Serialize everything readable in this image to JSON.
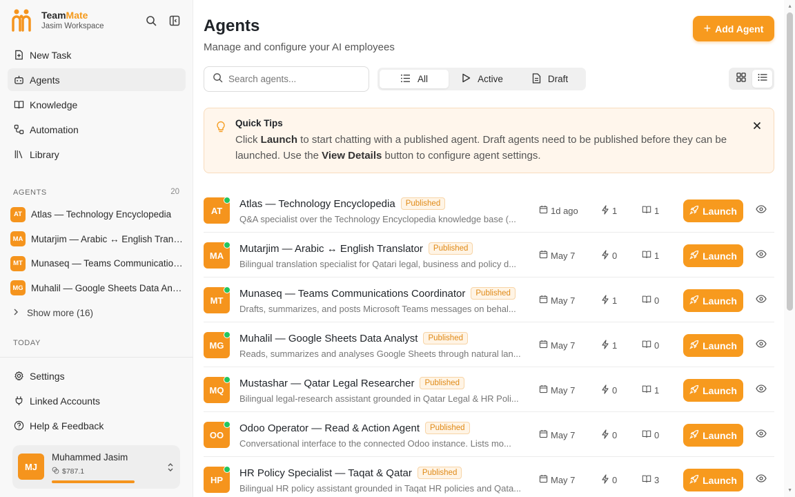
{
  "brand": {
    "name_part1": "Team",
    "name_part2": "Mate",
    "workspace": "Jasim Workspace"
  },
  "nav": [
    {
      "label": "New Task",
      "icon": "new-task-icon"
    },
    {
      "label": "Agents",
      "icon": "robot-icon",
      "active": true
    },
    {
      "label": "Knowledge",
      "icon": "book-icon"
    },
    {
      "label": "Automation",
      "icon": "workflow-icon"
    },
    {
      "label": "Library",
      "icon": "library-icon"
    }
  ],
  "sidebar_agents": {
    "title": "AGENTS",
    "count": "20",
    "items": [
      {
        "initials": "AT",
        "name": "Atlas — Technology Encyclopedia"
      },
      {
        "initials": "MA",
        "name": "Mutarjim — Arabic ↔ English Translator"
      },
      {
        "initials": "MT",
        "name": "Munaseq — Teams Communications Coordinator"
      },
      {
        "initials": "MG",
        "name": "Muhalil — Google Sheets Data Analyst"
      }
    ],
    "show_more": "Show more (16)"
  },
  "today_title": "TODAY",
  "bottom_nav": [
    {
      "label": "Settings",
      "icon": "gear-icon"
    },
    {
      "label": "Linked Accounts",
      "icon": "plug-icon"
    },
    {
      "label": "Help & Feedback",
      "icon": "help-icon"
    }
  ],
  "user": {
    "initials": "MJ",
    "name": "Muhammed Jasim",
    "balance": "$787.1"
  },
  "header": {
    "title": "Agents",
    "subtitle": "Manage and configure your AI employees",
    "add_button": "Add Agent"
  },
  "search": {
    "placeholder": "Search agents..."
  },
  "filters": [
    {
      "label": "All",
      "active": true
    },
    {
      "label": "Active"
    },
    {
      "label": "Draft"
    }
  ],
  "tips": {
    "title": "Quick Tips",
    "p1": "Click ",
    "b1": "Launch",
    "p2": " to start chatting with a published agent. Draft agents need to be published before they can be launched. Use the ",
    "b2": "View Details",
    "p3": " button to configure agent settings."
  },
  "launch_label": "Launch",
  "agents": [
    {
      "initials": "AT",
      "name": "Atlas — Technology Encyclopedia",
      "status": "Published",
      "desc": "Q&A specialist over the Technology Encyclopedia knowledge base (...",
      "date": "1d ago",
      "runs": "1",
      "kb": "1"
    },
    {
      "initials": "MA",
      "name": "Mutarjim — Arabic ↔ English Translator",
      "status": "Published",
      "desc": "Bilingual translation specialist for Qatari legal, business and policy d...",
      "date": "May 7",
      "runs": "0",
      "kb": "1"
    },
    {
      "initials": "MT",
      "name": "Munaseq — Teams Communications Coordinator",
      "status": "Published",
      "desc": "Drafts, summarizes, and posts Microsoft Teams messages on behal...",
      "date": "May 7",
      "runs": "1",
      "kb": "0"
    },
    {
      "initials": "MG",
      "name": "Muhalil — Google Sheets Data Analyst",
      "status": "Published",
      "desc": "Reads, summarizes and analyses Google Sheets through natural lan...",
      "date": "May 7",
      "runs": "1",
      "kb": "0"
    },
    {
      "initials": "MQ",
      "name": "Mustashar — Qatar Legal Researcher",
      "status": "Published",
      "desc": "Bilingual legal-research assistant grounded in Qatar Legal & HR Poli...",
      "date": "May 7",
      "runs": "0",
      "kb": "1"
    },
    {
      "initials": "OO",
      "name": "Odoo Operator — Read & Action Agent",
      "status": "Published",
      "desc": "Conversational interface to the connected Odoo instance. Lists mo...",
      "date": "May 7",
      "runs": "0",
      "kb": "0"
    },
    {
      "initials": "HP",
      "name": "HR Policy Specialist — Taqat & Qatar",
      "status": "Published",
      "desc": "Bilingual HR policy assistant grounded in Taqat HR policies and Qata...",
      "date": "May 7",
      "runs": "0",
      "kb": "3"
    }
  ],
  "colors": {
    "accent": "#f79a1e",
    "online": "#22c55e",
    "tips_bg": "#fff6ec"
  }
}
